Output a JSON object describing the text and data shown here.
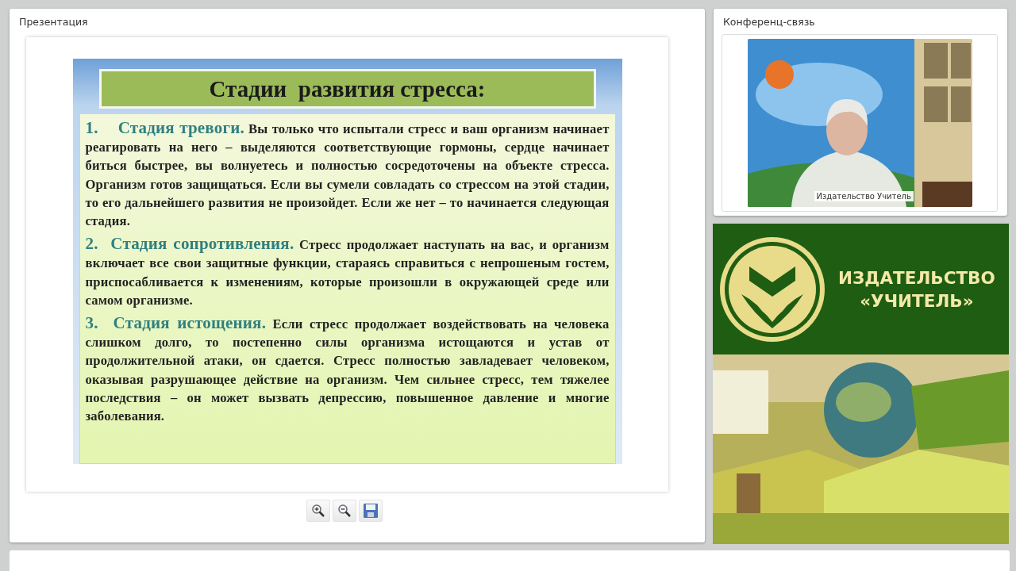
{
  "presentation": {
    "title": "Презентация",
    "slide": {
      "heading": "Стадии  развития стресса:",
      "paragraphs": [
        "**1.    Стадия тревоги.** Вы только что испытали стресс и ваш организм начинает реагировать на него – выделяются соответствующие гормоны, сердце начинает биться быстрее, вы волнуетесь и полностью сосредоточены на объекте стресса. Организм готов защищаться. Если вы сумели совладать со стрессом на этой стадии, то его дальнейшего развития не произойдет. Если же нет – то начинается следующая стадия.",
        "**2.  Стадия сопротивления.** Стресс продолжает наступать на вас, и организм включает все свои защитные функции, стараясь справиться с непрошеным гостем, приспосабливается к изменениям, которые произошли в окружающей среде или самом организме.",
        "**3.  Стадия истощения.** Если стресс продолжает воздействовать на человека слишком долго, то постепенно силы организма истощаются и устав от продолжительной атаки, он сдается. Стресс полностью завладевает человеком, оказывая разрушающее действие на организм. Чем сильнее стресс, тем тяжелее последствия – он может вызвать депрессию, повышенное давление и многие заболевания."
      ]
    },
    "toolbar": [
      {
        "kind": "zoom-in"
      },
      {
        "kind": "zoom-out"
      },
      {
        "kind": "save"
      }
    ]
  },
  "conference": {
    "title": "Конференц-связь",
    "video": {
      "kind": "picture",
      "caption": "Издательство Учитель"
    }
  },
  "banner": {
    "lines": [
      "ИЗДАТЕЛЬСТВО",
      "«УЧИТЕЛЬ»"
    ],
    "photo": {
      "kind": "picture"
    }
  }
}
